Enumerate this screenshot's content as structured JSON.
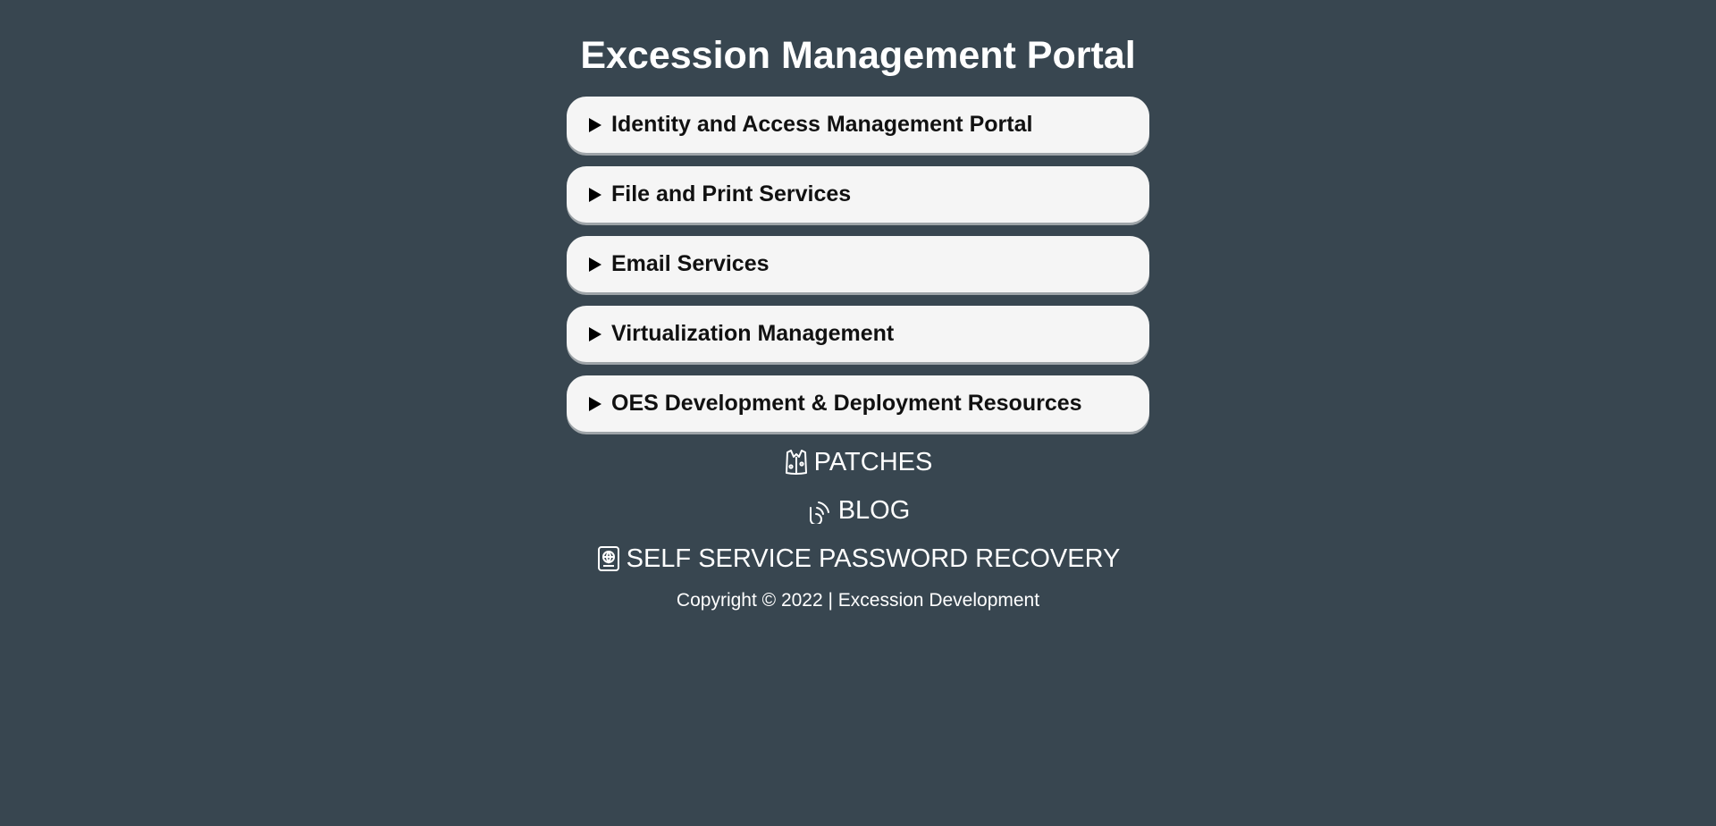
{
  "page": {
    "title": "Excession Management Portal"
  },
  "sections": [
    {
      "label": "Identity and Access Management Portal"
    },
    {
      "label": "File and Print Services"
    },
    {
      "label": "Email Services"
    },
    {
      "label": "Virtualization Management"
    },
    {
      "label": "OES Development & Deployment Resources"
    }
  ],
  "links": {
    "patches": {
      "label": "PATCHES",
      "icon": "vest-icon"
    },
    "blog": {
      "label": "BLOG",
      "icon": "rss-icon"
    },
    "password_recovery": {
      "label": "SELF SERVICE PASSWORD RECOVERY",
      "icon": "passport-icon"
    }
  },
  "footer": {
    "copyright": "Copyright © 2022 | Excession Development"
  },
  "colors": {
    "background": "#384650",
    "card": "#f5f5f5",
    "text_light": "#ffffff",
    "text_dark": "#111111"
  }
}
